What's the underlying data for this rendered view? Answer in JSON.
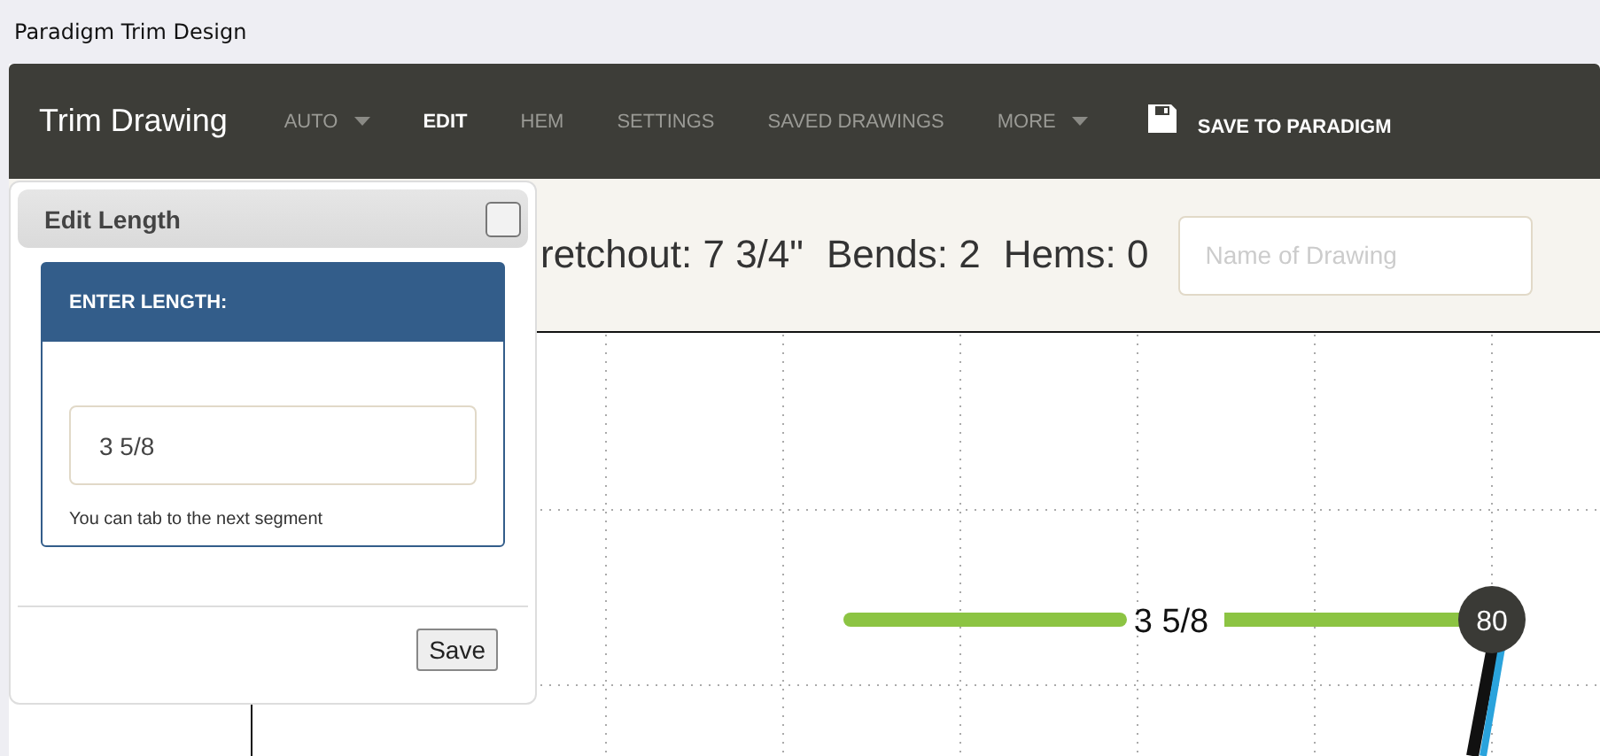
{
  "window": {
    "title": "Paradigm Trim Design"
  },
  "navbar": {
    "brand": "Trim Drawing",
    "items": [
      {
        "label": "AUTO",
        "kind": "menu",
        "selected": false,
        "dropdown": true
      },
      {
        "label": "EDIT",
        "kind": "menu",
        "selected": true,
        "dropdown": false
      },
      {
        "label": "HEM",
        "kind": "menu",
        "selected": false,
        "dropdown": false
      },
      {
        "label": "SETTINGS",
        "kind": "menu",
        "selected": false,
        "dropdown": false
      },
      {
        "label": "SAVED DRAWINGS",
        "kind": "menu",
        "selected": false,
        "dropdown": false
      },
      {
        "label": "MORE",
        "kind": "menu",
        "selected": false,
        "dropdown": true
      },
      {
        "label": "SAVE TO PARADIGM",
        "kind": "action",
        "selected": false,
        "dropdown": false
      }
    ]
  },
  "stats": [
    "retchout: 7 3/4\"",
    "Bends: 2",
    "Hems: 0"
  ],
  "name_field": {
    "placeholder": "Name of Drawing"
  },
  "drawing": {
    "segment_label": "3 5/8",
    "bend_angle": "80"
  },
  "dialog": {
    "title": "Edit Length",
    "panel_heading": "ENTER LENGTH:",
    "length_field": {
      "value": "3 5/8"
    },
    "help": "You can tab to the next segment",
    "button": "Save"
  }
}
